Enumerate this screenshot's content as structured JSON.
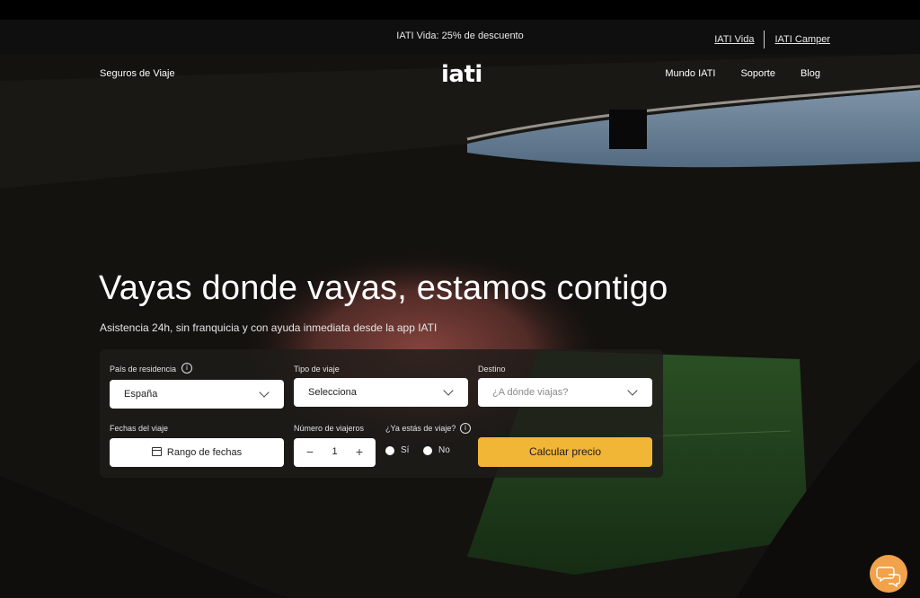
{
  "promo": {
    "message": "IATI Vida: 25% de descuento",
    "links": [
      "IATI Vida",
      "IATI Camper"
    ]
  },
  "nav": {
    "left": "Seguros de Viaje",
    "logo": "iati",
    "right": [
      "Mundo IATI",
      "Soporte",
      "Blog"
    ]
  },
  "hero": {
    "title": "Vayas donde vayas, estamos contigo",
    "subtitle": "Asistencia 24h, sin franquicia y con ayuda inmediata desde la app IATI"
  },
  "form": {
    "residence": {
      "label": "País de residencia",
      "value": "España"
    },
    "trip_type": {
      "label": "Tipo de viaje",
      "value": "Selecciona"
    },
    "destination": {
      "label": "Destino",
      "placeholder": "¿A dónde viajas?"
    },
    "dates": {
      "label": "Fechas del viaje",
      "value": "Rango de fechas"
    },
    "travelers": {
      "label": "Número de viajeros",
      "value": "1"
    },
    "traveling": {
      "label": "¿Ya estás de viaje?",
      "options": [
        "Sí",
        "No"
      ]
    },
    "submit": "Calcular precio"
  },
  "colors": {
    "accent": "#f1b635",
    "chat": "#f1a24a"
  },
  "icons": [
    "info-icon",
    "chevron-down-icon",
    "calendar-icon",
    "minus-icon",
    "plus-icon",
    "chat-icon"
  ]
}
